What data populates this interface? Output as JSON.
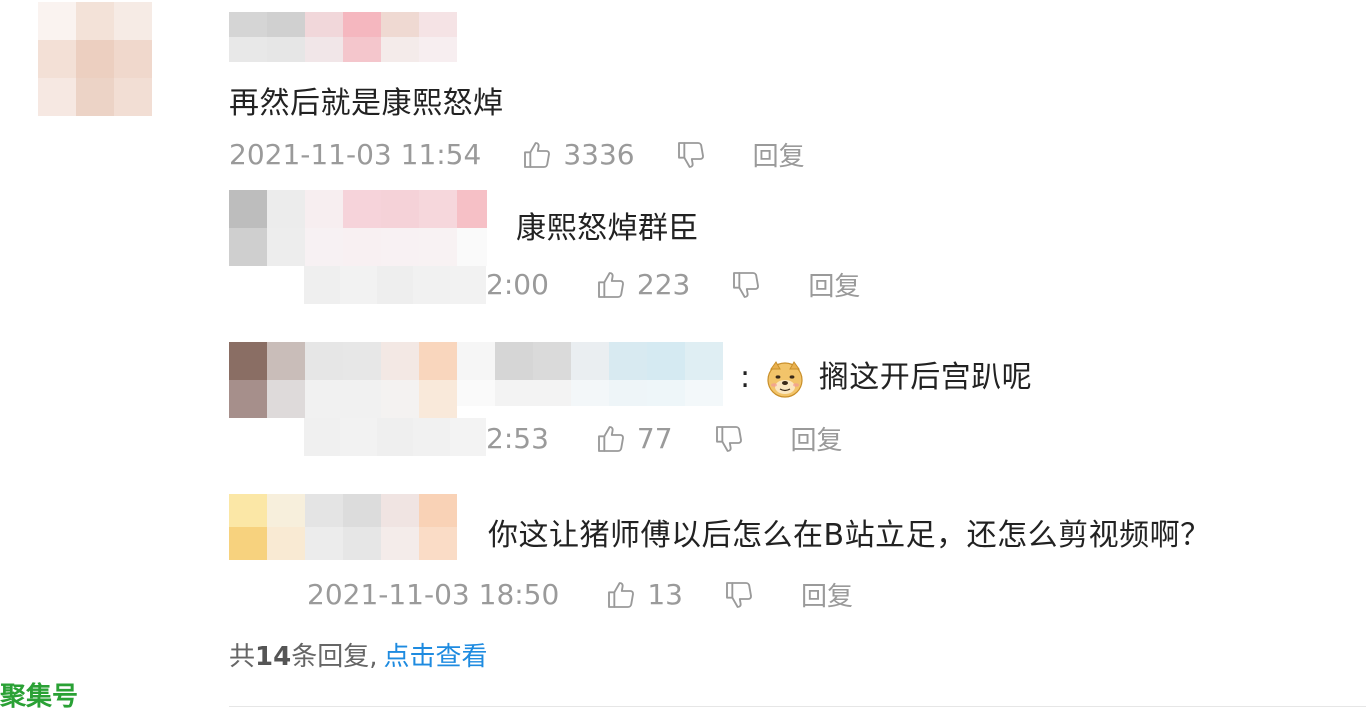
{
  "main_comment": {
    "text": "再然后就是康熙怒焯",
    "time": "2021-11-03 11:54",
    "likes": "3336",
    "reply_label": "回复"
  },
  "replies": [
    {
      "text": "康熙怒焯群臣",
      "time": "2:00",
      "likes": "223",
      "reply_label": "回复"
    },
    {
      "prefix": ":",
      "text": "搁这开后宫趴呢",
      "emoji": "doge-emoji",
      "time": "2:53",
      "likes": "77",
      "reply_label": "回复"
    },
    {
      "text": "你这让猪师傅以后怎么在B站立足，还怎么剪视频啊？",
      "time": "2021-11-03 18:50",
      "likes": "13",
      "reply_label": "回复"
    }
  ],
  "footer": {
    "prefix": "共",
    "count": "14",
    "suffix": "条回复,",
    "link": "点击查看"
  },
  "watermark": "聚集号",
  "colors": {
    "text": "#222222",
    "meta": "#9a9a9a",
    "link": "#1e8be0",
    "watermark": "#2aa135"
  },
  "icons": [
    "thumbs-up-icon",
    "thumbs-down-icon",
    "doge-emoji"
  ]
}
